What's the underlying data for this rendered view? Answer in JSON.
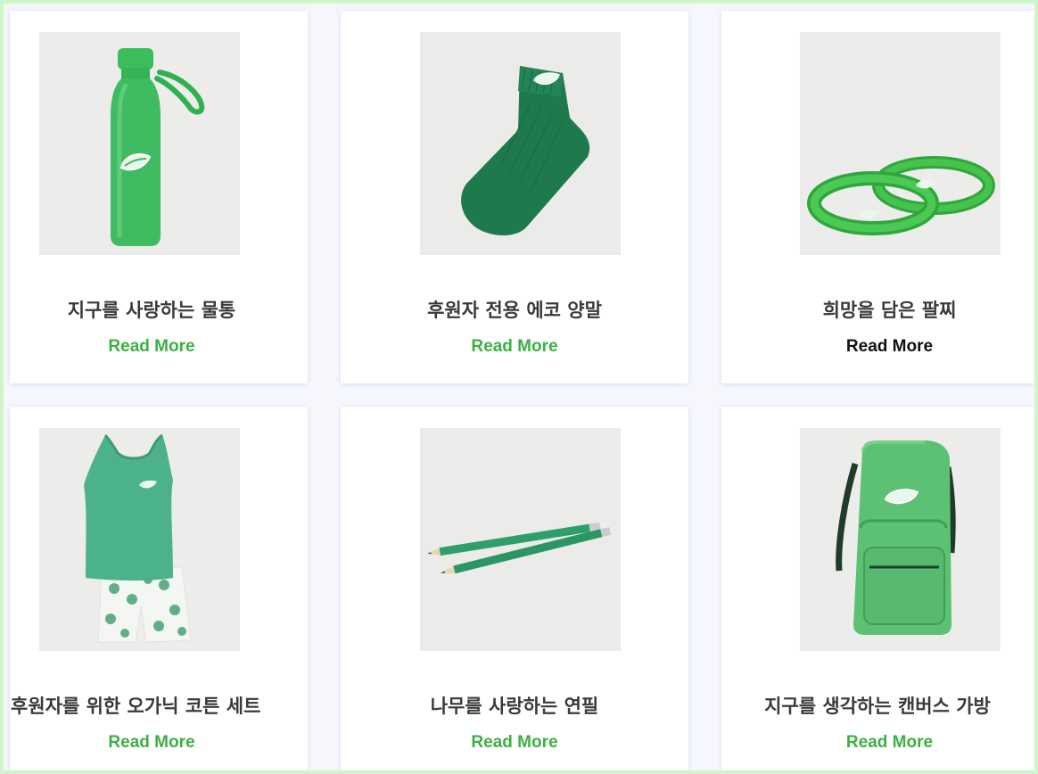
{
  "products": [
    {
      "title": "지구를 사랑하는 물통",
      "link": "Read More",
      "icon": "water-bottle",
      "link_color": "#3cb043"
    },
    {
      "title": "후원자 전용 에코 양말",
      "link": "Read More",
      "icon": "sock",
      "link_color": "#3cb043"
    },
    {
      "title": "희망을 담은 팔찌",
      "link": "Read More",
      "icon": "wristband",
      "link_color": "#111111"
    },
    {
      "title": "후원자를 위한 오가닉 코튼 세트",
      "link": "Read More",
      "icon": "tank-top-shorts",
      "link_color": "#3cb043"
    },
    {
      "title": "나무를 사랑하는 연필",
      "link": "Read More",
      "icon": "pencils",
      "link_color": "#3cb043"
    },
    {
      "title": "지구를 생각하는 캔버스 가방",
      "link": "Read More",
      "icon": "backpack",
      "link_color": "#3cb043"
    }
  ],
  "colors": {
    "border": "#ccf7c6",
    "background": "#f6f7fd",
    "accent": "#3cb043",
    "title": "#3a3a3a"
  }
}
